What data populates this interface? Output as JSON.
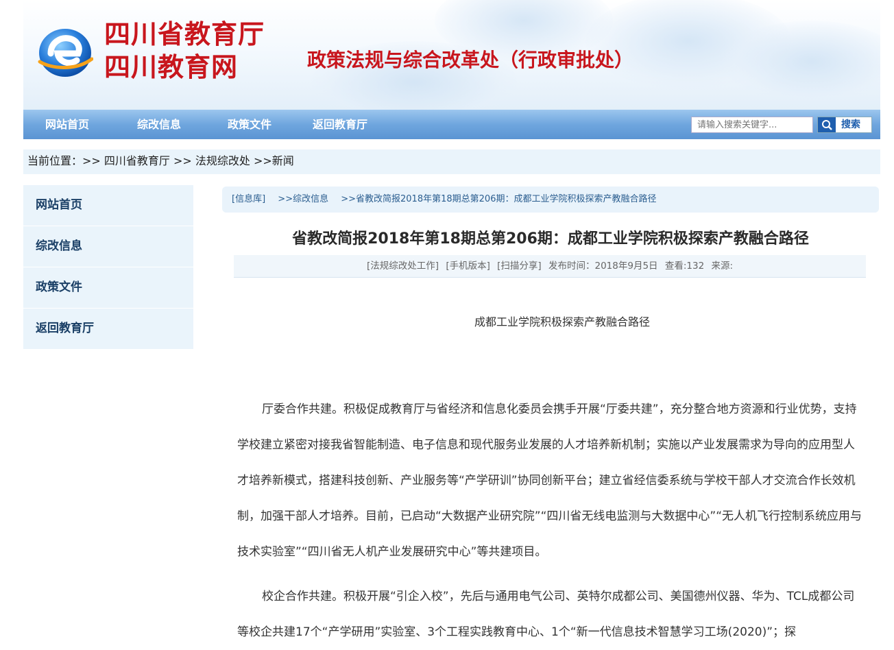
{
  "header": {
    "logo_line1": "四川省教育厅",
    "logo_line2": "四川教育网",
    "dept_title": "政策法规与综合改革处（行政审批处）",
    "brand_red": "#c8161d",
    "logo_icon": "e-globe-logo"
  },
  "nav": {
    "items": [
      "网站首页",
      "综改信息",
      "政策文件",
      "返回教育厅"
    ],
    "search_placeholder": "请输入搜索关键字...",
    "search_label": "搜索"
  },
  "breadcrumb": "当前位置：>> 四川省教育厅 >> 法规综改处 >>新闻",
  "sidebar": {
    "items": [
      "网站首页",
      "综改信息",
      "政策文件",
      "返回教育厅"
    ]
  },
  "article": {
    "path": [
      "[信息库]",
      ">>综改信息",
      ">>省教改简报2018年第18期总第206期：成都工业学院积极探索产教融合路径"
    ],
    "title": "省教改简报2018年第18期总第206期：成都工业学院积极探索产教融合路径",
    "meta": [
      "[法规综改处工作]",
      "[手机版本]",
      "[扫描分享]",
      "发布时间：2018年9月5日",
      "查看:132",
      "来源:"
    ],
    "subhead": "成都工业学院积极探索产教融合路径",
    "paragraphs": [
      "厅委合作共建。积极促成教育厅与省经济和信息化委员会携手开展“厅委共建”，充分整合地方资源和行业优势，支持学校建立紧密对接我省智能制造、电子信息和现代服务业发展的人才培养新机制；实施以产业发展需求为导向的应用型人才培养新模式，搭建科技创新、产业服务等“产学研训”协同创新平台；建立省经信委系统与学校干部人才交流合作长效机制，加强干部人才培养。目前，已启动“大数据产业研究院”“四川省无线电监测与大数据中心”“无人机飞行控制系统应用与技术实验室”“四川省无人机产业发展研究中心”等共建项目。",
      "校企合作共建。积极开展“引企入校”，先后与通用电气公司、英特尔成都公司、美国德州仪器、华为、TCL成都公司等校企共建17个“产学研用”实验室、3个工程实践教育中心、1个“新一代信息技术智慧学习工场(2020)”；探"
    ]
  }
}
